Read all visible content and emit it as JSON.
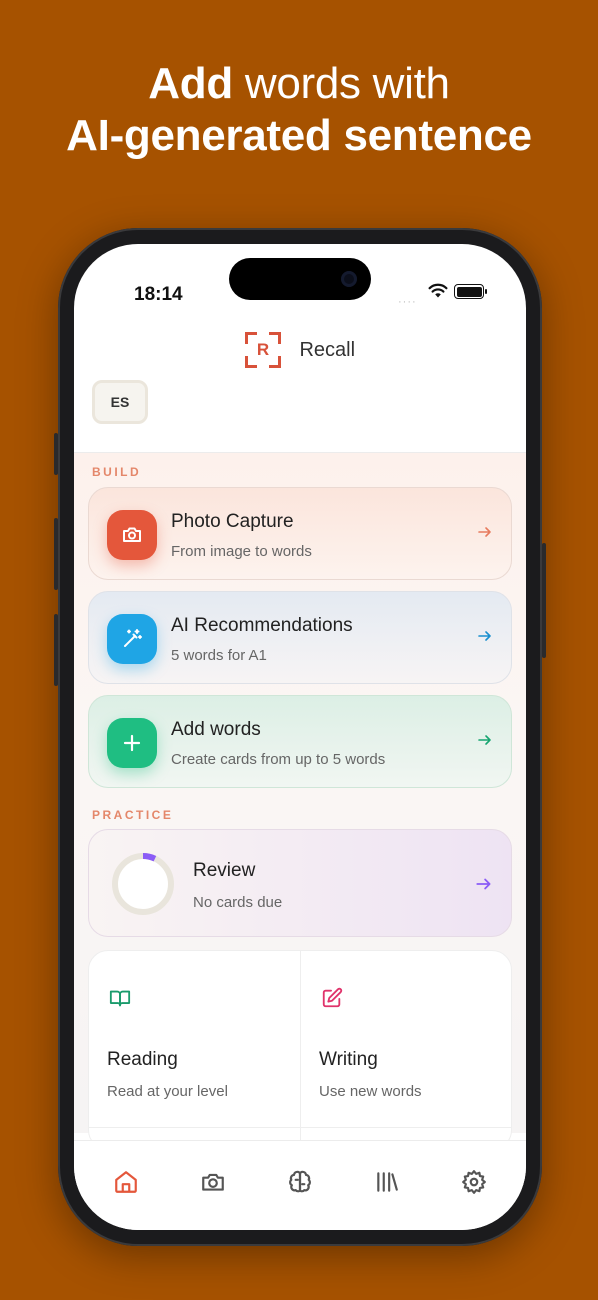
{
  "headline": {
    "bold1": "Add",
    "rest1": " words with",
    "line2": "AI-generated sentence"
  },
  "status_bar": {
    "time": "18:14",
    "signal": "····"
  },
  "app": {
    "logo_letter": "R",
    "name": "Recall",
    "language_code": "ES"
  },
  "build": {
    "section_label": "BUILD",
    "cards": [
      {
        "title": "Photo Capture",
        "subtitle": "From image to words",
        "icon": "camera-icon",
        "accent": "#e4573b"
      },
      {
        "title": "AI Recommendations",
        "subtitle": "5 words for A1",
        "icon": "magic-wand-icon",
        "accent": "#1fa5e5"
      },
      {
        "title": "Add words",
        "subtitle": "Create cards from up to 5 words",
        "icon": "plus-icon",
        "accent": "#1fbe82"
      }
    ]
  },
  "practice": {
    "section_label": "PRACTICE",
    "review": {
      "title": "Review",
      "subtitle": "No cards due",
      "progress_fraction": 0.07,
      "accent": "#8b5cf6"
    },
    "tiles": [
      {
        "title": "Reading",
        "subtitle": "Read at your level",
        "icon": "book-open-icon",
        "accent": "#1a9b6c"
      },
      {
        "title": "Writing",
        "subtitle": "Use new words",
        "icon": "edit-icon",
        "accent": "#e0336b"
      }
    ]
  },
  "tab_bar": {
    "items": [
      {
        "icon": "home-icon",
        "active": true
      },
      {
        "icon": "camera-icon",
        "active": false
      },
      {
        "icon": "brain-icon",
        "active": false
      },
      {
        "icon": "library-icon",
        "active": false
      },
      {
        "icon": "settings-icon",
        "active": false
      }
    ],
    "active_color": "#e4573b",
    "inactive_color": "#555555"
  },
  "colors": {
    "background": "#a65200",
    "brand": "#d8523a"
  }
}
